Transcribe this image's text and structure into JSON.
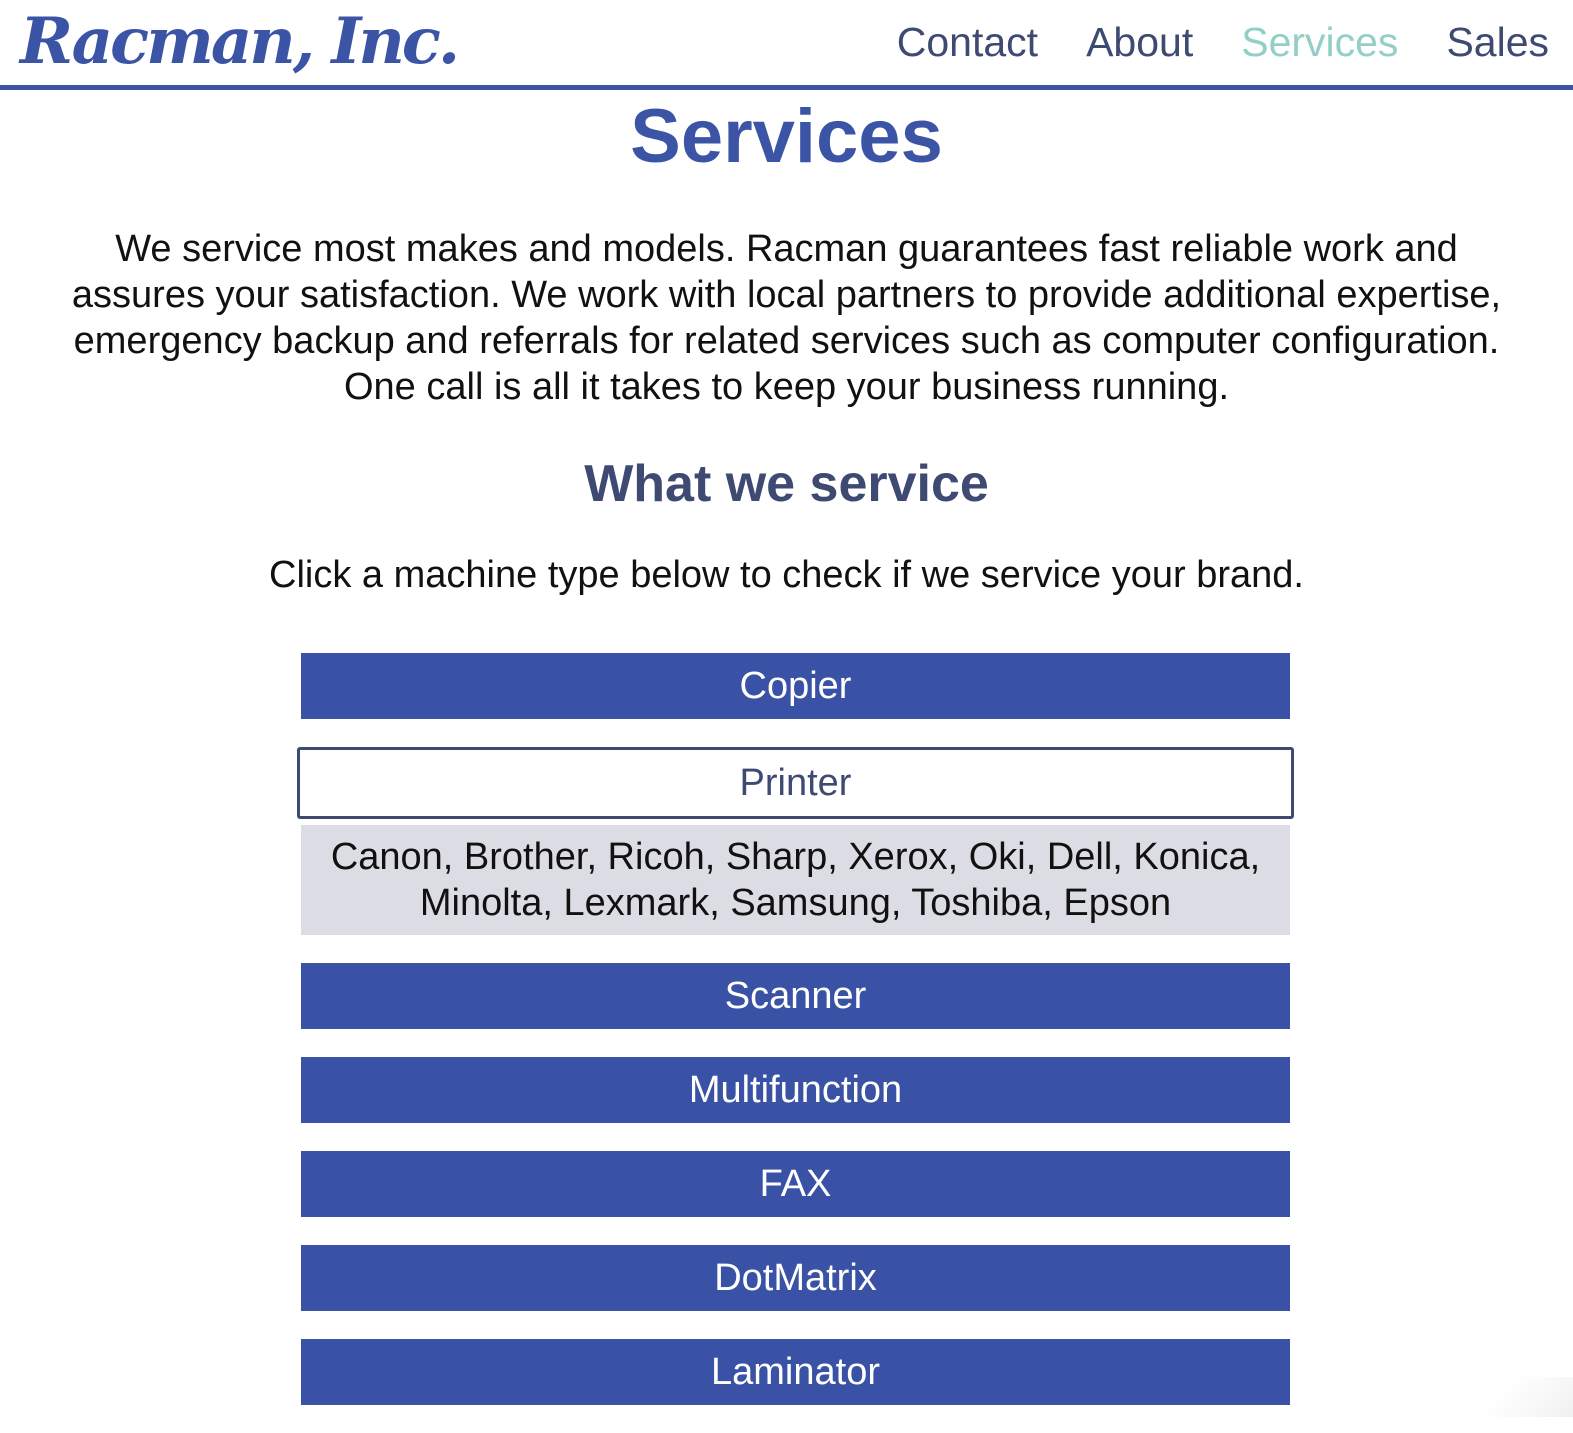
{
  "header": {
    "logo": "Racman, Inc.",
    "nav": [
      {
        "label": "Contact",
        "active": false
      },
      {
        "label": "About",
        "active": false
      },
      {
        "label": "Services",
        "active": true
      },
      {
        "label": "Sales",
        "active": false
      }
    ]
  },
  "main": {
    "title": "Services",
    "intro": "We service most makes and models. Racman guarantees fast reliable work and assures your satisfaction. We work with local partners to provide additional expertise, emergency backup and referrals for related services such as computer configuration. One call is all it takes to keep your business running.",
    "subtitle": "What we service",
    "instructions": "Click a machine type below to check if we service your brand.",
    "machines": [
      {
        "label": "Copier",
        "expanded": false
      },
      {
        "label": "Printer",
        "expanded": true,
        "brands": "Canon, Brother, Ricoh, Sharp, Xerox, Oki, Dell, Konica, Minolta, Lexmark, Samsung, Toshiba, Epson"
      },
      {
        "label": "Scanner",
        "expanded": false
      },
      {
        "label": "Multifunction",
        "expanded": false
      },
      {
        "label": "FAX",
        "expanded": false
      },
      {
        "label": "DotMatrix",
        "expanded": false
      },
      {
        "label": "Laminator",
        "expanded": false
      }
    ]
  },
  "colors": {
    "brand_blue": "#3a52a6",
    "nav_text": "#3f4a73",
    "nav_active": "#93cfc7",
    "panel_bg": "#dcdde4"
  }
}
